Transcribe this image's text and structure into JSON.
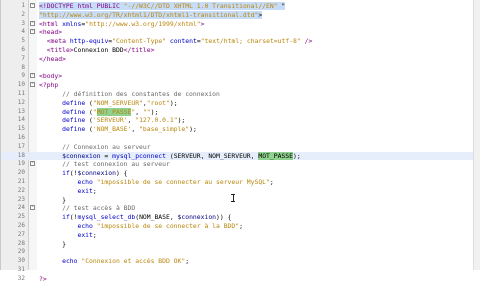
{
  "editor": {
    "lines": [
      {
        "n": "1",
        "fold": "-",
        "html": "<span class=\"hl-sel\"><span class=\"t\">&lt;!DOCTYPE html PUBLIC</span> <span class=\"s\">\"-//W3C//DTD XHTML 1.0 Transitional//EN\"</span> \"</span>"
      },
      {
        "n": "2",
        "fold": "",
        "html": "<span class=\"hl-sel\"><span class=\"s\">\"http://www.w3.org/TR/xhtml1/DTD/xhtml1-transitional.dtd\"</span>&gt;</span>"
      },
      {
        "n": "3",
        "fold": "-",
        "html": "<span class=\"t\">&lt;html</span> <span class=\"k\">xmlns</span>=<span class=\"s\">\"http://www.w3.org/1999/xhtml\"</span><span class=\"t\">&gt;</span>"
      },
      {
        "n": "4",
        "fold": "-",
        "html": "<span class=\"t\">&lt;head&gt;</span>"
      },
      {
        "n": "5",
        "fold": "",
        "html": "  <span class=\"t\">&lt;meta</span> <span class=\"k\">http-equiv</span>=<span class=\"s\">\"Content-Type\"</span> <span class=\"k\">content</span>=<span class=\"s\">\"text/html; charset=utf-8\"</span> <span class=\"t\">/&gt;</span>"
      },
      {
        "n": "6",
        "fold": "",
        "html": "  <span class=\"t\">&lt;title&gt;</span>Connexion BDD<span class=\"t\">&lt;/title&gt;</span>"
      },
      {
        "n": "7",
        "fold": "",
        "html": "<span class=\"t\">&lt;/head&gt;</span>"
      },
      {
        "n": "8",
        "fold": "",
        "html": ""
      },
      {
        "n": "9",
        "fold": "-",
        "html": "<span class=\"t\">&lt;body&gt;</span>"
      },
      {
        "n": "10",
        "fold": "-",
        "html": "<span class=\"t\">&lt;?php</span>"
      },
      {
        "n": "11",
        "fold": "",
        "html": "      <span class=\"c\">// définition des constantes de connexion</span>"
      },
      {
        "n": "12",
        "fold": "",
        "html": "      <span class=\"k\">define</span> (<span class=\"s\">\"NOM_SERVEUR\"</span>,<span class=\"s\">\"root\"</span>);"
      },
      {
        "n": "13",
        "fold": "",
        "html": "      <span class=\"k\">define</span> (<span class=\"s\">\"<span class=\"hl-match\">MOT_PASSE</span>\"</span>, <span class=\"s\">\"\"</span>);"
      },
      {
        "n": "14",
        "fold": "",
        "html": "      <span class=\"k\">define</span> (<span class=\"s\">'SERVEUR'</span>, <span class=\"s\">\"127.0.0.1\"</span>);"
      },
      {
        "n": "15",
        "fold": "",
        "html": "      <span class=\"k\">define</span> (<span class=\"s\">'NOM_BASE'</span>, <span class=\"s\">\"base_simple\"</span>);"
      },
      {
        "n": "16",
        "fold": "",
        "html": ""
      },
      {
        "n": "17",
        "fold": "",
        "html": "      <span class=\"c\">// Connexion au serveur</span>"
      },
      {
        "n": "18",
        "fold": "",
        "active": true,
        "html": "      <span class=\"v\">$connexion</span> = <span class=\"k\">mysql_pconnect</span> (SERVEUR, NOM_SERVEUR, <span class=\"hl-match\">MOT_PASSE</span>);"
      },
      {
        "n": "19",
        "fold": "-",
        "html": "      <span class=\"c\">// test connexion au serveur</span>"
      },
      {
        "n": "20",
        "fold": "",
        "html": "      <span class=\"k\">if</span>(!<span class=\"v\">$connexion</span>) {"
      },
      {
        "n": "21",
        "fold": "",
        "html": "          <span class=\"k\">echo</span> <span class=\"s\">\"impossible de se connecter au serveur MySQL\"</span>;"
      },
      {
        "n": "22",
        "fold": "",
        "html": "          <span class=\"k\">exit</span>;"
      },
      {
        "n": "23",
        "fold": "",
        "html": "      }"
      },
      {
        "n": "24",
        "fold": "-",
        "html": "      <span class=\"c\">// test accès à BDD</span>"
      },
      {
        "n": "25",
        "fold": "",
        "html": "      <span class=\"k\">if</span>(!<span class=\"k\">mysql_select_db</span>(NOM_BASE, <span class=\"v\">$connexion</span>)) {"
      },
      {
        "n": "26",
        "fold": "",
        "html": "          <span class=\"k\">echo</span> <span class=\"s\">\"impossible de se connecter à la BDD\"</span>;"
      },
      {
        "n": "27",
        "fold": "",
        "html": "          <span class=\"k\">exit</span>;"
      },
      {
        "n": "28",
        "fold": "",
        "html": "      }"
      },
      {
        "n": "29",
        "fold": "",
        "html": ""
      },
      {
        "n": "30",
        "fold": "",
        "html": "      <span class=\"k\">echo</span> <span class=\"s\">\"Connexion et accès BDD OK\"</span>;"
      },
      {
        "n": "31",
        "fold": "",
        "html": ""
      },
      {
        "n": "32",
        "fold": "",
        "html": "<span class=\"t\">?&gt;</span>"
      }
    ]
  }
}
